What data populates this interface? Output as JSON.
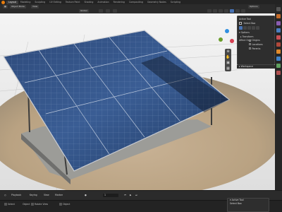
{
  "app": {
    "brand_color": "#e87d0d",
    "accent_color": "#4772b3"
  },
  "workspaces": [
    "Layout",
    "Modeling",
    "Sculpting",
    "UV Editing",
    "Texture Paint",
    "Shading",
    "Animation",
    "Rendering",
    "Compositing",
    "Geometry Nodes",
    "Scripting"
  ],
  "active_workspace_index": 0,
  "viewport_header": {
    "mode": "Object Mode",
    "view": "View",
    "global": "Global",
    "options": "Options"
  },
  "active_tool_panel": {
    "title": "Active Tool",
    "select_box": "Select Box",
    "options_heading": "Options",
    "transform": "Transform",
    "affect_only_label": "Affect Only",
    "affect_items": [
      {
        "label": "Origins",
        "checked": false
      },
      {
        "label": "Locations",
        "checked": false
      },
      {
        "label": "Parents",
        "checked": false
      }
    ],
    "workspace": "Workspace"
  },
  "timeline": {
    "playback": "Playback",
    "keying": "Keying",
    "view": "View",
    "marker": "Marker",
    "frame_field": "1"
  },
  "statusbar": {
    "object_label": "Object",
    "select_label": "Select",
    "rotate_view": "Rotate View",
    "context_menu": "Object"
  },
  "active_tool_popup": {
    "title": "Active Tool",
    "extras": "Select Box"
  }
}
